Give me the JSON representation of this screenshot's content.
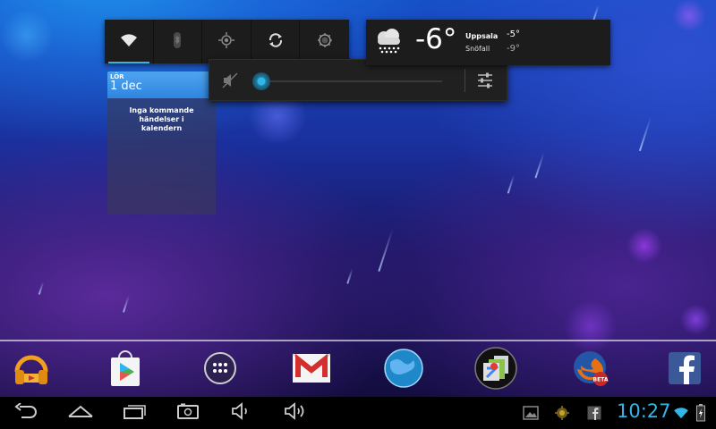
{
  "quick_settings": {
    "buttons": [
      {
        "icon": "wifi-icon",
        "active": true
      },
      {
        "icon": "bluetooth-icon",
        "active": false
      },
      {
        "icon": "gps-icon",
        "active": false
      },
      {
        "icon": "sync-icon",
        "active": false
      },
      {
        "icon": "brightness-icon",
        "active": false
      }
    ]
  },
  "volume": {
    "level": 0.0,
    "icons": [
      "speaker-muted-icon",
      "settings-sliders-icon"
    ],
    "accent": "#33b5e5"
  },
  "calendar": {
    "day": "LÖR",
    "date": "1 dec",
    "empty_message": "Inga kommande händelser i kalendern"
  },
  "weather": {
    "icon": "snow-cloud-icon",
    "temperature": "-6°",
    "city": "Uppsala",
    "condition": "Snöfall",
    "high": "-5°",
    "low": "-9°"
  },
  "dock": {
    "apps": [
      {
        "icon": "play-music-icon"
      },
      {
        "icon": "play-store-icon"
      },
      {
        "icon": "app-drawer-icon"
      },
      {
        "icon": "gmail-icon"
      },
      {
        "icon": "earth-icon"
      },
      {
        "icon": "maps-icon"
      },
      {
        "icon": "firefox-beta-icon"
      },
      {
        "icon": "facebook-icon"
      }
    ]
  },
  "navbar": {
    "buttons": [
      "back-icon",
      "home-icon",
      "recents-icon",
      "screenshot-icon",
      "volume-down-icon",
      "volume-up-icon"
    ],
    "status_icons": [
      "gallery-notification-icon",
      "app-notification-icon",
      "facebook-notification-icon",
      "wifi-icon",
      "battery-icon"
    ],
    "clock": "10:27"
  },
  "colors": {
    "accent": "#33b5e5",
    "panel": "#1c1c1c"
  }
}
